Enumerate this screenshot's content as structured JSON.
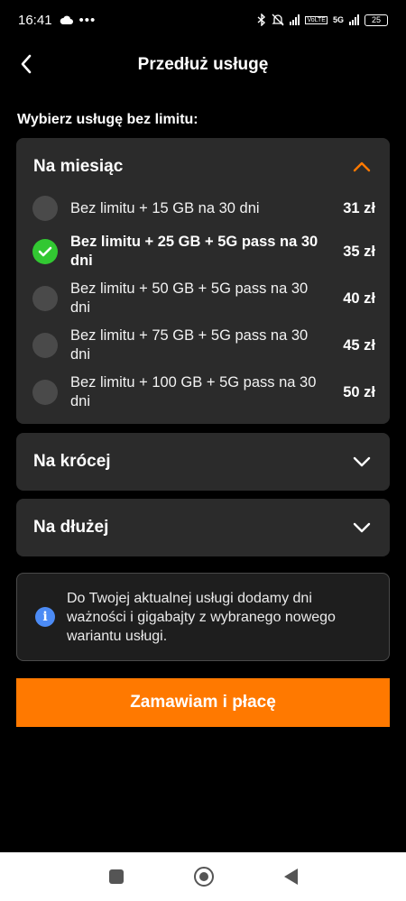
{
  "status_bar": {
    "time": "16:41",
    "battery": "25",
    "network": "5G",
    "volte": "VoLTE"
  },
  "header": {
    "title": "Przedłuż usługę"
  },
  "section_label": "Wybierz usługę bez limitu:",
  "groups": [
    {
      "label": "Na miesiąc",
      "expanded": true,
      "options": [
        {
          "label": "Bez limitu + 15 GB na 30 dni",
          "price": "31 zł",
          "selected": false
        },
        {
          "label": "Bez limitu + 25 GB + 5G pass na 30 dni",
          "price": "35 zł",
          "selected": true
        },
        {
          "label": "Bez limitu + 50 GB + 5G pass na 30 dni",
          "price": "40 zł",
          "selected": false
        },
        {
          "label": "Bez limitu + 75 GB + 5G pass na 30 dni",
          "price": "45 zł",
          "selected": false
        },
        {
          "label": "Bez limitu + 100 GB + 5G pass na 30 dni",
          "price": "50 zł",
          "selected": false
        }
      ]
    },
    {
      "label": "Na krócej",
      "expanded": false
    },
    {
      "label": "Na dłużej",
      "expanded": false
    }
  ],
  "info": {
    "text": "Do Twojej aktualnej usługi dodamy dni ważności i gigabajty z wybranego nowego wariantu usługi."
  },
  "cta": {
    "label": "Zamawiam i płacę"
  },
  "colors": {
    "accent": "#ff7900",
    "selected": "#32c832",
    "info": "#4c8bf5",
    "card": "#2b2b2b"
  }
}
